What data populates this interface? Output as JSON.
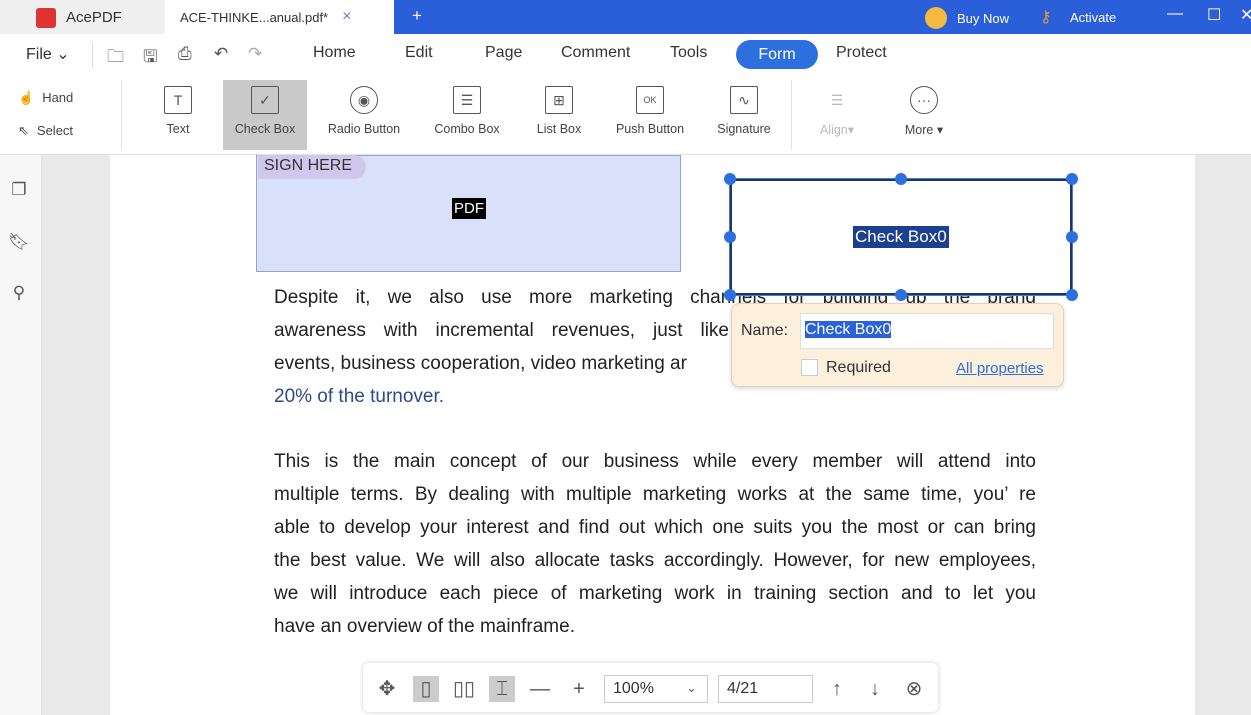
{
  "titlebar": {
    "app_name": "AcePDF",
    "doc_tab": "ACE-THINKE...anual.pdf*",
    "close_tab": "×",
    "new_tab": "+",
    "buy_now": "Buy Now",
    "activate": "Activate",
    "minimize": "—",
    "maximize": "☐",
    "close": "✕"
  },
  "menu": {
    "file": "File ⌄",
    "tabs": [
      "Home",
      "Edit",
      "Page",
      "Comment",
      "Tools",
      "Form",
      "Protect"
    ],
    "active_tab": "Form"
  },
  "ribbon": {
    "hand": "Hand",
    "select": "Select",
    "tools": [
      "Text",
      "Check Box",
      "Radio Button",
      "Combo Box",
      "List Box",
      "Push Button",
      "Signature"
    ],
    "active_tool": "Check Box",
    "align": "Align▾",
    "more": "More ▾"
  },
  "document": {
    "sign_here": "SIGN HERE",
    "pdf_tag": "PDF",
    "field_label": "Check Box0",
    "para1": [
      "Despite it, we also use more marketing channels for building up the brand",
      "awareness with incremental revenues, just like",
      "events, business cooperation, video marketing ar",
      "20% of the turnover."
    ],
    "para2": [
      "This is the main concept of our business while every member will attend into",
      "multiple terms. By dealing with multiple marketing works at the same time, you’ re",
      "able to develop your interest and find out which one suits you the most or can bring",
      "the best value. We will also allocate tasks accordingly. However, for new employees,",
      "we will introduce each piece of marketing work in training section and to let you",
      "have an overview of the mainframe."
    ]
  },
  "popup": {
    "name_label": "Name:",
    "name_value": "Check Box0",
    "required_label": "Required",
    "required_checked": false,
    "all_properties": "All properties"
  },
  "bottombar": {
    "zoom": "100%",
    "page": "4/21"
  },
  "colors": {
    "accent": "#2e6fe0",
    "titlebar": "#2b5fd9",
    "link_text": "#2e4a86"
  }
}
